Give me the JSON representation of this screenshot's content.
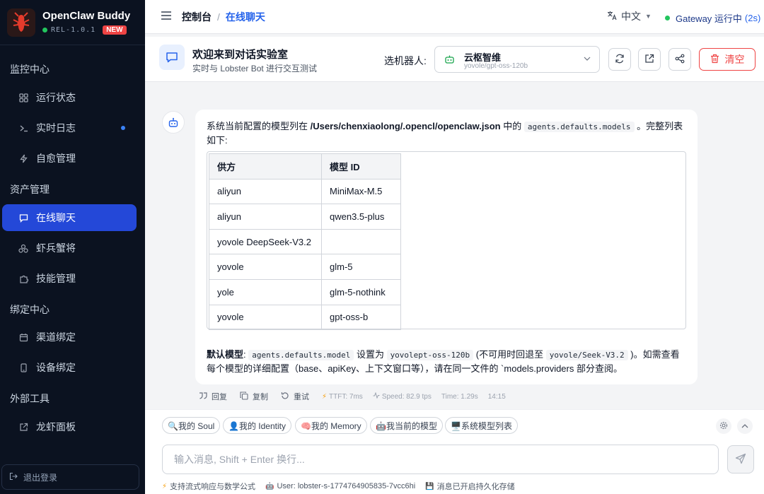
{
  "brand": {
    "name": "OpenClaw Buddy",
    "release": "REL-1.0.1",
    "badge": "NEW"
  },
  "sidebar": {
    "groups": [
      {
        "label": "监控中心",
        "items": [
          {
            "label": "运行状态",
            "icon": "grid-icon"
          },
          {
            "label": "实时日志",
            "icon": "terminal-icon",
            "has_dot": true
          },
          {
            "label": "自愈管理",
            "icon": "bolt-icon"
          }
        ]
      },
      {
        "label": "资产管理",
        "items": [
          {
            "label": "在线聊天",
            "icon": "chat-icon",
            "active": true
          },
          {
            "label": "虾兵蟹将",
            "icon": "bot-group-icon"
          },
          {
            "label": "技能管理",
            "icon": "puzzle-icon"
          }
        ]
      },
      {
        "label": "绑定中心",
        "items": [
          {
            "label": "渠道绑定",
            "icon": "calendar-icon"
          },
          {
            "label": "设备绑定",
            "icon": "device-icon"
          }
        ]
      },
      {
        "label": "外部工具",
        "items": [
          {
            "label": "龙虾面板",
            "icon": "external-link-icon"
          }
        ]
      }
    ],
    "logout_label": "退出登录"
  },
  "topbar": {
    "breadcrumb_root": "控制台",
    "breadcrumb_sep": "/",
    "breadcrumb_current": "在线聊天",
    "language": "中文",
    "gateway_status": "Gateway 运行中",
    "gateway_uptime": "(2s)"
  },
  "chat_header": {
    "title": "欢迎来到对话实验室",
    "subtitle": "实时与 Lobster Bot 进行交互测试",
    "robot_label": "选机器人:",
    "robot_name": "云枢智维",
    "robot_model": "yovole/gpt-oss-120b",
    "clear_label": "清空"
  },
  "message": {
    "intro_a": "系统当前配置的模型列在 ",
    "intro_path": "/Users/chenxiaolong/.opencl/openclaw.json",
    "intro_b": " 中的 ",
    "intro_code": "agents.defaults.models",
    "intro_c": " 。完整列表如下:",
    "table": {
      "headers": [
        "供方",
        "模型 ID"
      ],
      "rows": [
        [
          "aliyun",
          "MiniMax-M.5"
        ],
        [
          "aliyun",
          "qwen3.5-plus"
        ],
        [
          "yovole DeepSeek-V3.2",
          ""
        ],
        [
          "yovole",
          "glm-5"
        ],
        [
          "yole",
          "glm-5-nothink"
        ],
        [
          "yovole",
          "gpt-oss-b"
        ]
      ]
    },
    "default_label": "默认模型",
    "default_colon": ": ",
    "default_code1": "agents.defaults.model",
    "default_mid": " 设置为 ",
    "default_code2": "yovolept-oss-120b",
    "default_paren": " (不可用时回退至 ",
    "default_code3": "yovole/Seek-V3.2",
    "default_tail": " )。如需查看每个模型的详细配置（base、apiKey、上下文窗口等），请在同一文件的 `models.providers 部分查阅。",
    "actions": {
      "reply": "回复",
      "copy": "复制",
      "retry": "重试"
    },
    "metrics": {
      "ttft": "TTFT: 7ms",
      "speed": "Speed: 82.9 tps",
      "time": "Time: 1.29s",
      "clock": "14:15"
    }
  },
  "quick_chips": [
    {
      "label": "🔍我的 Soul",
      "icon": "magnifier-icon"
    },
    {
      "label": "👤我的 Identity",
      "icon": "person-icon"
    },
    {
      "label": "🧠我的 Memory",
      "icon": "brain-icon"
    },
    {
      "label": "🤖我当前的模型",
      "icon": "robot-icon"
    },
    {
      "label": "🖥️系统模型列表",
      "icon": "monitor-icon"
    }
  ],
  "composer": {
    "placeholder": "输入消息, Shift + Enter 换行...",
    "value": ""
  },
  "footer": {
    "streaming": "支持流式响应与数学公式",
    "user": "User: lobster-s-1774764905835-7vcc6hi",
    "persist": "消息已开启持久化存储"
  },
  "colors": {
    "accent": "#2448d8",
    "danger": "#ef4444",
    "online": "#22c55e",
    "sidebar_bg": "#0b1220"
  }
}
